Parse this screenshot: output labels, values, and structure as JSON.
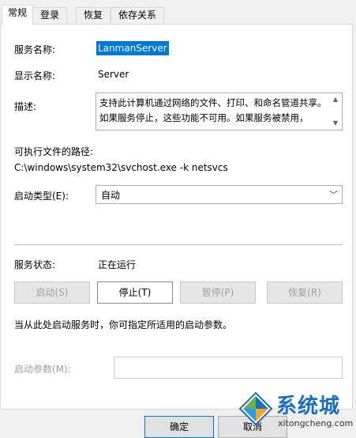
{
  "tabs": [
    "常规",
    "登录",
    "恢复",
    "依存关系"
  ],
  "fields": {
    "service_name_label": "服务名称:",
    "service_name": "LanmanServer",
    "display_name_label": "显示名称:",
    "display_name": "Server",
    "description_label": "描述:",
    "description": "支持此计算机通过网络的文件、打印、和命名管道共享。如果服务停止，这些功能不可用。如果服务被禁用，",
    "exe_path_label": "可执行文件的路径:",
    "exe_path": "C:\\windows\\system32\\svchost.exe -k netsvcs",
    "startup_type_label": "启动类型(E):",
    "startup_type": "自动"
  },
  "status": {
    "label": "服务状态:",
    "value": "正在运行"
  },
  "buttons": {
    "start": "启动(S)",
    "stop": "停止(T)",
    "pause": "暂停(P)",
    "resume": "恢复(R)"
  },
  "hint": "当从此处启动服务时，你可指定所适用的启动参数。",
  "start_params_label": "启动参数(M):",
  "start_params_value": "",
  "dialog_buttons": {
    "ok": "确定",
    "cancel": "取消"
  },
  "watermark": {
    "brand": "系统城",
    "url": "xitongcheng.com"
  },
  "colors": {
    "selection": "#0078d7",
    "watermark_blue": "#1a6fc1"
  }
}
